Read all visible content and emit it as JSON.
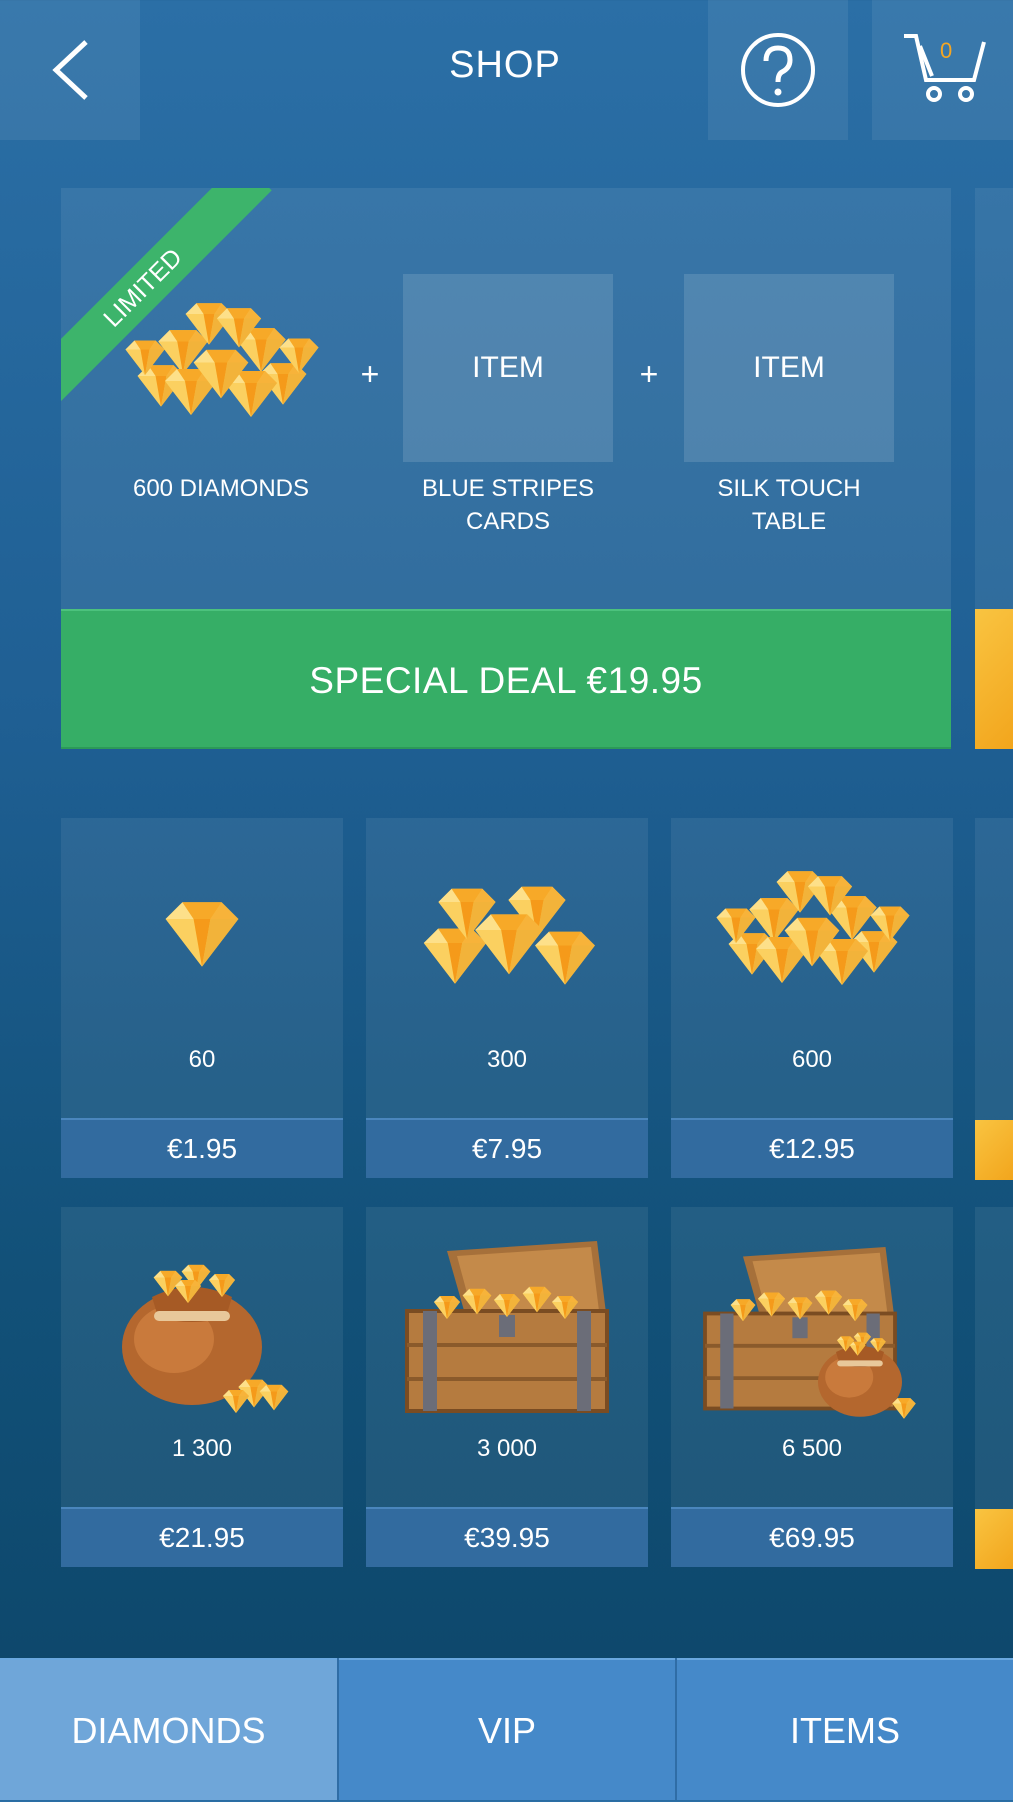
{
  "header": {
    "title": "SHOP",
    "cart_count": "0"
  },
  "deal": {
    "badge": "LIMITED",
    "items": [
      {
        "label": "600 DIAMONDS"
      },
      {
        "box_label": "ITEM",
        "label_line1": "BLUE STRIPES",
        "label_line2": "CARDS"
      },
      {
        "box_label": "ITEM",
        "label_line1": "SILK TOUCH",
        "label_line2": "TABLE"
      }
    ],
    "plus": "+",
    "button_label": "SPECIAL DEAL €19.95"
  },
  "products": [
    {
      "amount": "60",
      "price": "€1.95",
      "icon": "single-diamond-icon"
    },
    {
      "amount": "300",
      "price": "€7.95",
      "icon": "diamond-cluster-icon"
    },
    {
      "amount": "600",
      "price": "€12.95",
      "icon": "diamond-pile-icon"
    },
    {
      "amount": "1 300",
      "price": "€21.95",
      "icon": "diamond-bag-icon"
    },
    {
      "amount": "3 000",
      "price": "€39.95",
      "icon": "treasure-chest-icon"
    },
    {
      "amount": "6 500",
      "price": "€69.95",
      "icon": "chest-and-bag-icon"
    }
  ],
  "tabs": [
    {
      "label": "DIAMONDS",
      "active": true
    },
    {
      "label": "VIP",
      "active": false
    },
    {
      "label": "ITEMS",
      "active": false
    }
  ],
  "colors": {
    "accent_green": "#36ae66",
    "price_bar": "#326b9f",
    "tab_active": "#6fa6d9",
    "tab": "#4589c9",
    "gold": "#f7b928",
    "cart_count": "#f5a623"
  }
}
